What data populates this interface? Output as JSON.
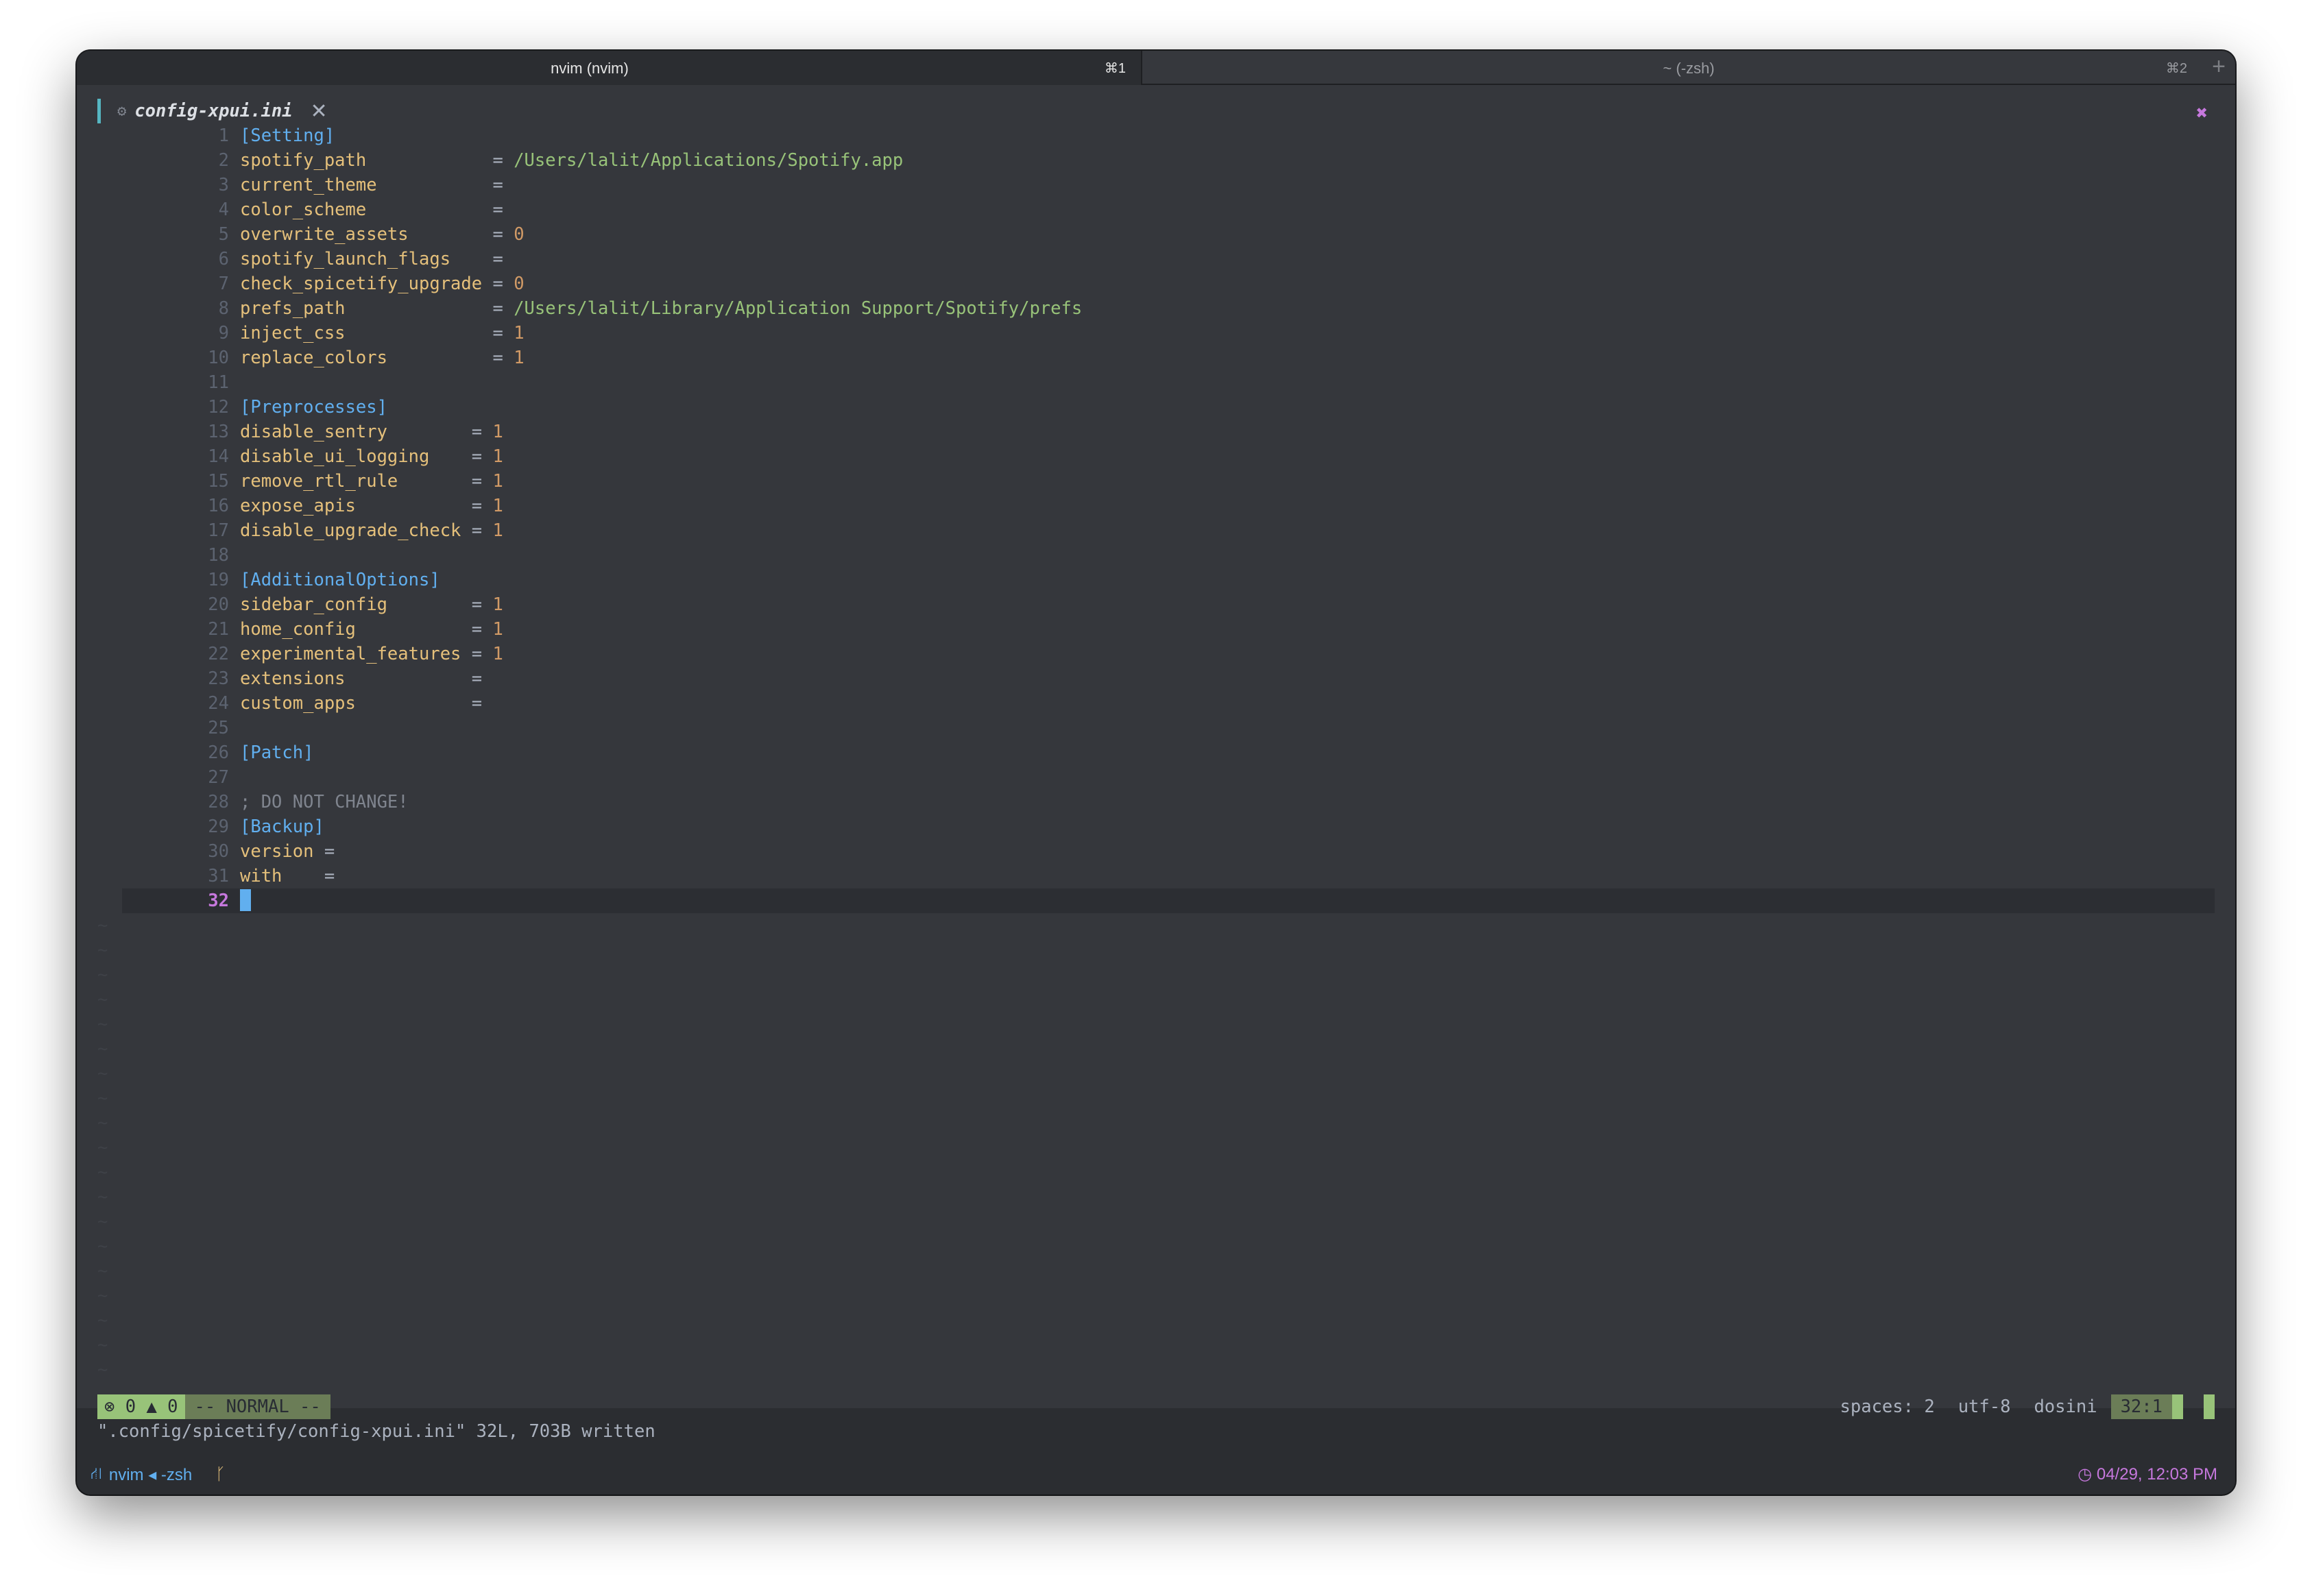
{
  "tabs": [
    {
      "title": "nvim (nvim)",
      "shortcut": "⌘1"
    },
    {
      "title": "~ (-zsh)",
      "shortcut": "⌘2"
    }
  ],
  "new_tab_symbol": "+",
  "buffer": {
    "name": "config-xpui.ini",
    "close_symbol": "✕",
    "right_close_symbol": "✖"
  },
  "lines": [
    [
      {
        "t": "[Setting]",
        "c": "s"
      }
    ],
    [
      {
        "t": "spotify_path            ",
        "c": "k"
      },
      {
        "t": "= ",
        "c": "o"
      },
      {
        "t": "/Users/lalit/Applications/Spotify.app",
        "c": "v"
      }
    ],
    [
      {
        "t": "current_theme           ",
        "c": "k"
      },
      {
        "t": "=",
        "c": "o"
      }
    ],
    [
      {
        "t": "color_scheme            ",
        "c": "k"
      },
      {
        "t": "=",
        "c": "o"
      }
    ],
    [
      {
        "t": "overwrite_assets        ",
        "c": "k"
      },
      {
        "t": "= ",
        "c": "o"
      },
      {
        "t": "0",
        "c": "n"
      }
    ],
    [
      {
        "t": "spotify_launch_flags    ",
        "c": "k"
      },
      {
        "t": "=",
        "c": "o"
      }
    ],
    [
      {
        "t": "check_spicetify_upgrade ",
        "c": "k"
      },
      {
        "t": "= ",
        "c": "o"
      },
      {
        "t": "0",
        "c": "n"
      }
    ],
    [
      {
        "t": "prefs_path              ",
        "c": "k"
      },
      {
        "t": "= ",
        "c": "o"
      },
      {
        "t": "/Users/lalit/Library/Application Support/Spotify/prefs",
        "c": "v"
      }
    ],
    [
      {
        "t": "inject_css              ",
        "c": "k"
      },
      {
        "t": "= ",
        "c": "o"
      },
      {
        "t": "1",
        "c": "n"
      }
    ],
    [
      {
        "t": "replace_colors          ",
        "c": "k"
      },
      {
        "t": "= ",
        "c": "o"
      },
      {
        "t": "1",
        "c": "n"
      }
    ],
    [],
    [
      {
        "t": "[Preprocesses]",
        "c": "s"
      }
    ],
    [
      {
        "t": "disable_sentry        ",
        "c": "k"
      },
      {
        "t": "= ",
        "c": "o"
      },
      {
        "t": "1",
        "c": "n"
      }
    ],
    [
      {
        "t": "disable_ui_logging    ",
        "c": "k"
      },
      {
        "t": "= ",
        "c": "o"
      },
      {
        "t": "1",
        "c": "n"
      }
    ],
    [
      {
        "t": "remove_rtl_rule       ",
        "c": "k"
      },
      {
        "t": "= ",
        "c": "o"
      },
      {
        "t": "1",
        "c": "n"
      }
    ],
    [
      {
        "t": "expose_apis           ",
        "c": "k"
      },
      {
        "t": "= ",
        "c": "o"
      },
      {
        "t": "1",
        "c": "n"
      }
    ],
    [
      {
        "t": "disable_upgrade_check ",
        "c": "k"
      },
      {
        "t": "= ",
        "c": "o"
      },
      {
        "t": "1",
        "c": "n"
      }
    ],
    [],
    [
      {
        "t": "[AdditionalOptions]",
        "c": "s"
      }
    ],
    [
      {
        "t": "sidebar_config        ",
        "c": "k"
      },
      {
        "t": "= ",
        "c": "o"
      },
      {
        "t": "1",
        "c": "n"
      }
    ],
    [
      {
        "t": "home_config           ",
        "c": "k"
      },
      {
        "t": "= ",
        "c": "o"
      },
      {
        "t": "1",
        "c": "n"
      }
    ],
    [
      {
        "t": "experimental_features ",
        "c": "k"
      },
      {
        "t": "= ",
        "c": "o"
      },
      {
        "t": "1",
        "c": "n"
      }
    ],
    [
      {
        "t": "extensions            ",
        "c": "k"
      },
      {
        "t": "=",
        "c": "o"
      }
    ],
    [
      {
        "t": "custom_apps           ",
        "c": "k"
      },
      {
        "t": "=",
        "c": "o"
      }
    ],
    [],
    [
      {
        "t": "[Patch]",
        "c": "s"
      }
    ],
    [],
    [
      {
        "t": "; DO NOT CHANGE!",
        "c": "c"
      }
    ],
    [
      {
        "t": "[Backup]",
        "c": "s"
      }
    ],
    [
      {
        "t": "version ",
        "c": "k"
      },
      {
        "t": "=",
        "c": "o"
      }
    ],
    [
      {
        "t": "with    ",
        "c": "k"
      },
      {
        "t": "=",
        "c": "o"
      }
    ],
    []
  ],
  "cursor_line": 32,
  "tilde": "~",
  "status": {
    "errors": "0",
    "warnings": "0",
    "mode": "-- NORMAL --",
    "spaces": "spaces: 2",
    "encoding": "utf-8",
    "filetype": "dosini",
    "position": "32:1"
  },
  "message": "\".config/spicetify/config-xpui.ini\" 32L, 703B written",
  "bottom": {
    "left": "nvim ◂ -zsh",
    "branch_icon": "ᚴ",
    "datetime": "04/29, 12:03 PM"
  },
  "colors": {
    "background": "#35373c",
    "keyword": "#e5c07b",
    "section": "#61afef",
    "string": "#98c379",
    "number": "#d19a66",
    "accent": "#c678dd"
  }
}
